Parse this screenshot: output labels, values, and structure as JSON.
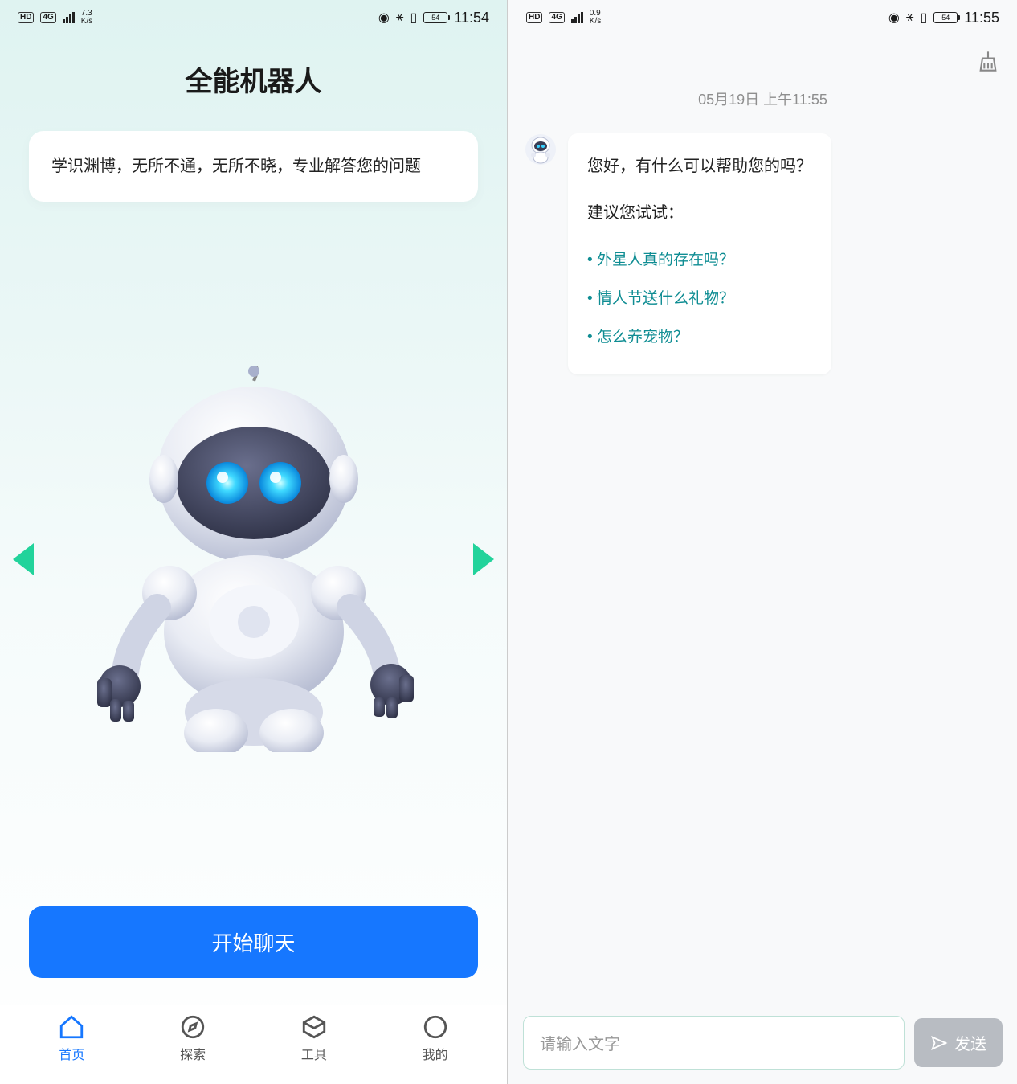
{
  "left": {
    "status": {
      "hd_badge": "HD",
      "net_badge": "4G",
      "kbps": "7.3",
      "kbps_unit": "K/s",
      "battery": "54",
      "clock": "11:54"
    },
    "title": "全能机器人",
    "description": "学识渊博，无所不通，无所不晓，专业解答您的问题",
    "start_button": "开始聊天",
    "tabs": [
      {
        "label": "首页",
        "icon": "home-icon",
        "active": true
      },
      {
        "label": "探索",
        "icon": "compass-icon",
        "active": false
      },
      {
        "label": "工具",
        "icon": "toolbox-icon",
        "active": false
      },
      {
        "label": "我的",
        "icon": "profile-icon",
        "active": false
      }
    ]
  },
  "right": {
    "status": {
      "hd_badge": "HD",
      "net_badge": "4G",
      "kbps": "0.9",
      "kbps_unit": "K/s",
      "battery": "54",
      "clock": "11:55"
    },
    "timestamp": "05月19日 上午11:55",
    "greeting": "您好，有什么可以帮助您的吗？",
    "suggest_title": "建议您试试：",
    "suggestions": [
      "外星人真的存在吗？",
      "情人节送什么礼物？",
      "怎么养宠物？"
    ],
    "input_placeholder": "请输入文字",
    "send_label": "发送"
  }
}
